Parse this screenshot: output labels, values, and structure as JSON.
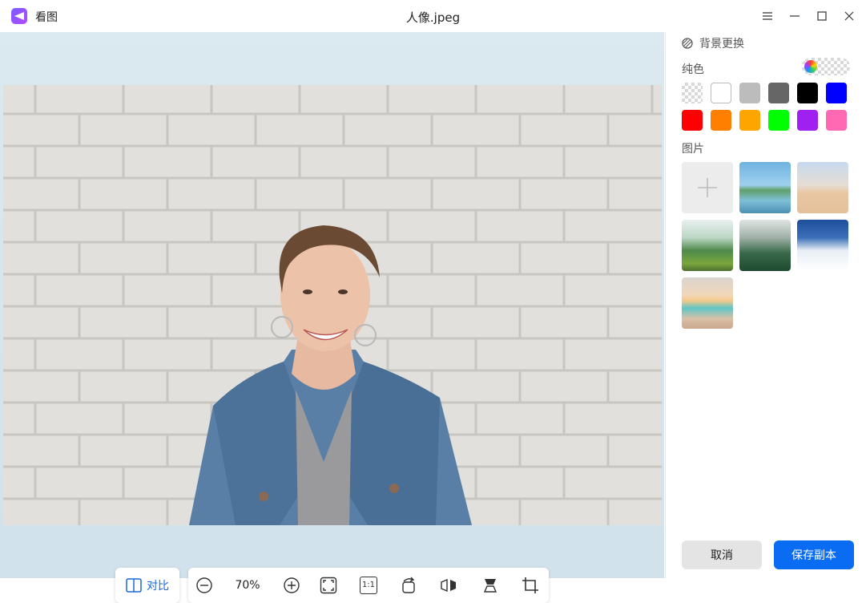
{
  "app": {
    "name": "看图",
    "window_title": "人像.jpeg"
  },
  "window_controls": [
    "menu-icon",
    "minimize-icon",
    "maximize-icon",
    "close-icon"
  ],
  "sidebar": {
    "section_title": "背景更换",
    "solid_label": "纯色",
    "colors": [
      "transparent",
      "#ffffff",
      "#bcbcbc",
      "#666666",
      "#000000",
      "#0000ff",
      "#ff0000",
      "#ff8000",
      "#ffa500",
      "#00ff00",
      "#a020f0",
      "#ff69b4"
    ],
    "image_label": "图片",
    "images": [
      "add-image",
      "lake-landscape",
      "desert-dunes",
      "green-valley",
      "misty-forest",
      "snow-mountains",
      "sunset-beach"
    ],
    "cancel_label": "取消",
    "save_label": "保存副本"
  },
  "toolbar": {
    "compare_label": "对比",
    "zoom": "70%",
    "ratio_label": "1:1",
    "tools": [
      "zoom-out-icon",
      "zoom-in-icon",
      "fit-window-icon",
      "original-size-icon",
      "rotate-icon",
      "flip-horizontal-icon",
      "flip-vertical-icon",
      "crop-icon"
    ]
  }
}
